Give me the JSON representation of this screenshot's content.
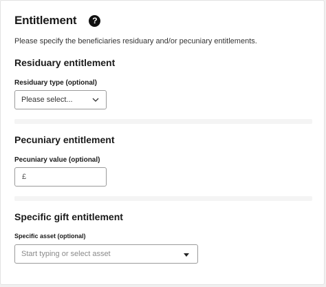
{
  "header": {
    "title": "Entitlement",
    "help_glyph": "?",
    "intro": "Please specify the beneficiaries residuary and/or pecuniary entitlements."
  },
  "residuary": {
    "heading": "Residuary entitlement",
    "label": "Residuary type (optional)",
    "selected": "Please select..."
  },
  "pecuniary": {
    "heading": "Pecuniary entitlement",
    "label": "Pecuniary value (optional)",
    "currency": "£",
    "value": ""
  },
  "specific_gift": {
    "heading": "Specific gift entitlement",
    "label": "Specific asset (optional)",
    "placeholder": "Start typing or select asset"
  },
  "icons": {
    "help": "help-icon",
    "residuary_dropdown": "chevron-down-icon",
    "asset_dropdown": "caret-down-icon"
  }
}
